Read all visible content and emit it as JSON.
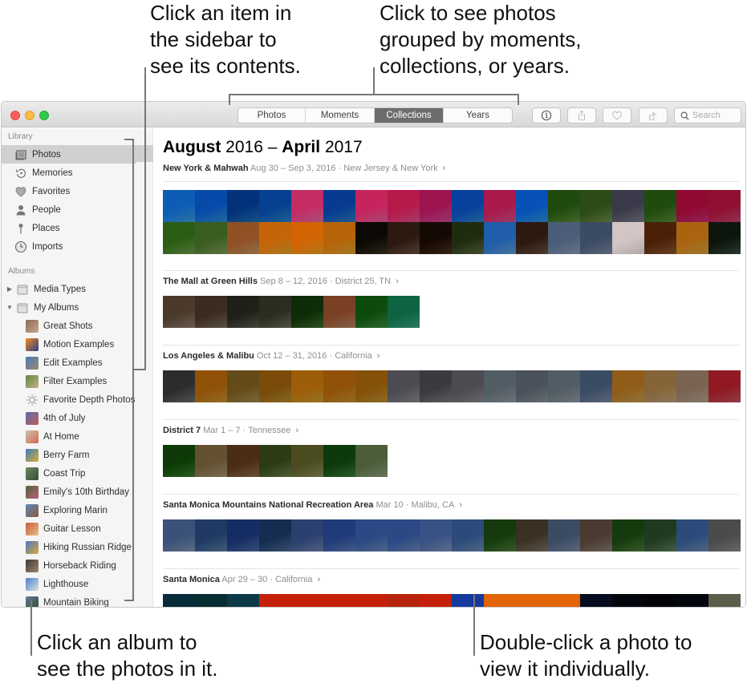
{
  "callouts": {
    "sidebar": [
      "Click an item in",
      "the sidebar to",
      "see its contents."
    ],
    "views": [
      "Click to see photos",
      "grouped by moments,",
      "collections, or years."
    ],
    "album": [
      "Click an album to",
      "see the photos in it."
    ],
    "photo": [
      "Double-click a photo to",
      "view it individually."
    ]
  },
  "toolbar": {
    "view_tabs": [
      {
        "label": "Photos",
        "active": false
      },
      {
        "label": "Moments",
        "active": false
      },
      {
        "label": "Collections",
        "active": true
      },
      {
        "label": "Years",
        "active": false
      }
    ],
    "buttons": [
      {
        "name": "info-button",
        "icon": "info-icon"
      },
      {
        "name": "share-button",
        "icon": "share-icon"
      },
      {
        "name": "favorite-button",
        "icon": "heart-icon"
      },
      {
        "name": "rotate-button",
        "icon": "rotate-icon"
      }
    ],
    "search_placeholder": "Search"
  },
  "sidebar": {
    "library_heading": "Library",
    "library": [
      {
        "label": "Photos",
        "icon": "photos-icon",
        "selected": true
      },
      {
        "label": "Memories",
        "icon": "memories-icon",
        "selected": false
      },
      {
        "label": "Favorites",
        "icon": "heart-icon",
        "selected": false
      },
      {
        "label": "People",
        "icon": "person-icon",
        "selected": false
      },
      {
        "label": "Places",
        "icon": "pin-icon",
        "selected": false
      },
      {
        "label": "Imports",
        "icon": "clock-icon",
        "selected": false
      }
    ],
    "albums_heading": "Albums",
    "album_folders": [
      {
        "label": "Media Types",
        "expanded": false
      },
      {
        "label": "My Albums",
        "expanded": true
      }
    ],
    "albums": [
      {
        "label": "Great Shots",
        "thumb": [
          "#8a6a55",
          "#c9a58a"
        ]
      },
      {
        "label": "Motion Examples",
        "thumb": [
          "#f28a1e",
          "#2c3c8a"
        ]
      },
      {
        "label": "Edit Examples",
        "thumb": [
          "#4a78b8",
          "#9a8a70"
        ]
      },
      {
        "label": "Filter Examples",
        "thumb": [
          "#5a8a3a",
          "#c7b08a"
        ]
      },
      {
        "label": "Favorite Depth Photos",
        "thumb": "gear"
      },
      {
        "label": "4th of July",
        "thumb": [
          "#5a6fb0",
          "#c05a5a"
        ]
      },
      {
        "label": "At Home",
        "thumb": [
          "#c9c0b5",
          "#d86a4a"
        ]
      },
      {
        "label": "Berry Farm",
        "thumb": [
          "#3a7ac0",
          "#d8b030"
        ]
      },
      {
        "label": "Coast Trip",
        "thumb": [
          "#6a8a5a",
          "#3a4a3a"
        ]
      },
      {
        "label": "Emily's 10th Birthday",
        "thumb": [
          "#4a6a3a",
          "#c05a7a"
        ]
      },
      {
        "label": "Exploring Marin",
        "thumb": [
          "#5a8ac0",
          "#8a5a3a"
        ]
      },
      {
        "label": "Guitar Lesson",
        "thumb": [
          "#c85a3a",
          "#e8c08a"
        ]
      },
      {
        "label": "Hiking Russian Ridge",
        "thumb": [
          "#4a7ac0",
          "#d8a83a"
        ]
      },
      {
        "label": "Horseback Riding",
        "thumb": [
          "#3a3a3a",
          "#a0846a"
        ]
      },
      {
        "label": "Lighthouse",
        "thumb": [
          "#4a80c8",
          "#e0e0e0"
        ]
      },
      {
        "label": "Mountain Biking",
        "thumb": [
          "#5a7aa0",
          "#3a4a2a"
        ]
      }
    ]
  },
  "main": {
    "title": {
      "month1": "August",
      "year1": "2016",
      "dash": "–",
      "month2": "April",
      "year2": "2017"
    },
    "collections": [
      {
        "name": "New York & Mahwah",
        "dates": "Aug 30 – Sep 3, 2016",
        "place": "New Jersey & New York",
        "photos": [
          "#3a9ad8",
          "#2a8ad0",
          "#1a70b0",
          "#2880c0",
          "#e06aa0",
          "#2a7ac0",
          "#e0609a",
          "#d8508a",
          "#c84890",
          "#2a80c8",
          "#d0508a",
          "#2a90d8",
          "#5a8a3a",
          "#6a8a4a",
          "#7a7a8a",
          "#5a8a3a",
          "#c03070",
          "#c04070",
          "#6a9a4a",
          "#7a9a5a",
          "#c09060",
          "#e0a030",
          "#e8a020",
          "#d8a030",
          "#3a3020",
          "#6a5040",
          "#4a3020",
          "#5a6a40",
          "#5a9ad0",
          "#6a5040",
          "#8a9ab0",
          "#7a8aa0",
          "#e8e0e0",
          "#8a5a30",
          "#d0a040",
          "#3a4a3a"
        ]
      },
      {
        "name": "The Mall at Green Hills",
        "dates": "Sep 8 – 12, 2016",
        "place": "District 25, TN",
        "photos": [
          "#8a7a6a",
          "#7a6a5a",
          "#5a5a50",
          "#6a6a5a",
          "#3a6a2a",
          "#b08060",
          "#3a8a3a",
          "#3aa080"
        ]
      },
      {
        "name": "Los Angeles & Malibu",
        "dates": "Oct 12 – 31, 2016",
        "place": "California",
        "photos": [
          "#6a6a6a",
          "#c09030",
          "#a08a50",
          "#b08a30",
          "#c89a30",
          "#c09030",
          "#b89030",
          "#8a8a90",
          "#7a7a80",
          "#8a8a90",
          "#909aa0",
          "#8a9098",
          "#909aa0",
          "#7a8aa0",
          "#c09a50",
          "#b8a078",
          "#b0a090",
          "#c05060"
        ]
      },
      {
        "name": "District 7",
        "dates": "Mar 1 – 7",
        "place": "Tennessee",
        "photos": [
          "#3a7a2a",
          "#a09070",
          "#8a6a4a",
          "#6a7a4a",
          "#8a8a5a",
          "#3a7a3a",
          "#8a9a7a"
        ]
      },
      {
        "name": "Santa Monica Mountains National Recreation Area",
        "dates": "Mar 10",
        "place": "Malibu, CA",
        "photos": [
          "#7a90b0",
          "#5a7aa0",
          "#4a6aa0",
          "#4a6a90",
          "#6a80a8",
          "#5a7ab0",
          "#6a88b8",
          "#6a88b8",
          "#7a90b8",
          "#6a8ab0",
          "#4a7a3a",
          "#7a7060",
          "#7a8aa0",
          "#8a7a70",
          "#4a7a3a",
          "#5a7a5a",
          "#6a8ab0",
          "#8a8a8a"
        ]
      },
      {
        "name": "Santa Monica",
        "dates": "Apr 29 – 30",
        "place": "California",
        "photos": [
          "#2a6a7a",
          "#2a6a70",
          "#3a7a88",
          "#e05a30",
          "#e05a30",
          "#e05a30",
          "#e05a30",
          "#d8603a",
          "#e05a30",
          "#4a7ac8",
          "#f0a030",
          "#f0a030",
          "#f0a020",
          "#2a3a5a",
          "#1a2a3a",
          "#1a2030",
          "#1a2a3a",
          "#9a9a8a"
        ]
      }
    ]
  }
}
